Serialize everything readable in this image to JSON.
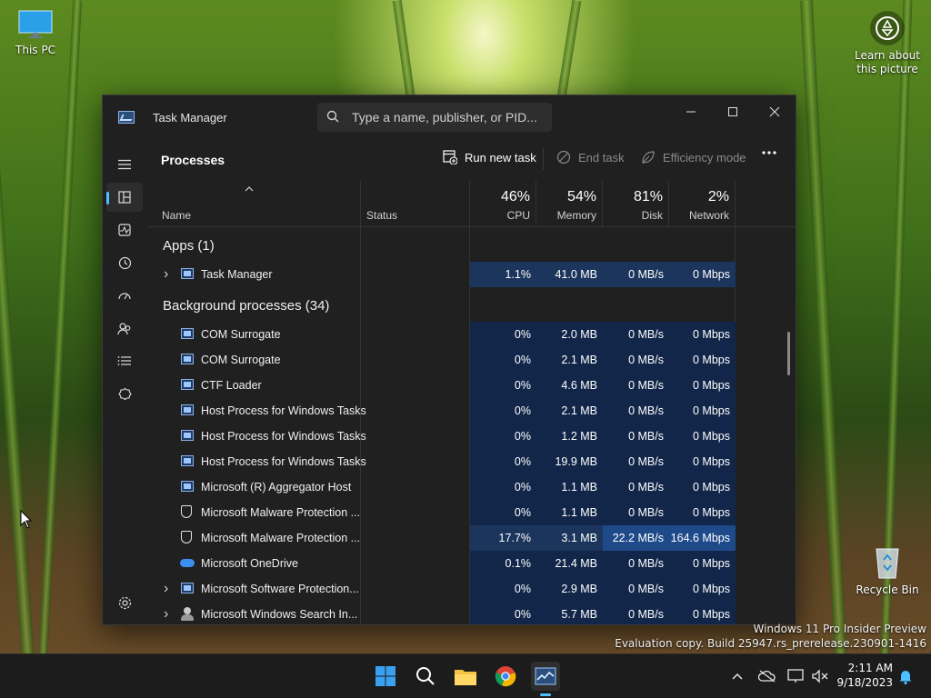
{
  "desktop": {
    "icons": [
      {
        "label": "This PC"
      },
      {
        "label": "Learn about this picture"
      },
      {
        "label": "Recycle Bin"
      }
    ]
  },
  "window": {
    "title": "Task Manager",
    "search_placeholder": "Type a name, publisher, or PID...",
    "controls": [
      "minimize",
      "maximize",
      "close"
    ]
  },
  "toolbar": {
    "page_title": "Processes",
    "run_new_task": "Run new task",
    "end_task": "End task",
    "efficiency_mode": "Efficiency mode",
    "more_icon": "more-icon"
  },
  "sidebar": {
    "items": [
      {
        "icon": "hamburger-icon",
        "name": "menu"
      },
      {
        "icon": "processes-icon",
        "name": "processes",
        "active": true
      },
      {
        "icon": "performance-icon",
        "name": "performance"
      },
      {
        "icon": "app-history-icon",
        "name": "app-history"
      },
      {
        "icon": "startup-apps-icon",
        "name": "startup-apps"
      },
      {
        "icon": "users-icon",
        "name": "users"
      },
      {
        "icon": "details-icon",
        "name": "details"
      },
      {
        "icon": "services-icon",
        "name": "services"
      },
      {
        "icon": "settings-icon",
        "name": "settings"
      }
    ]
  },
  "columns": {
    "name": "Name",
    "status": "Status",
    "cpu": {
      "label": "CPU",
      "pct": "46%"
    },
    "memory": {
      "label": "Memory",
      "pct": "54%"
    },
    "disk": {
      "label": "Disk",
      "pct": "81%"
    },
    "network": {
      "label": "Network",
      "pct": "2%"
    }
  },
  "groups": {
    "apps": "Apps (1)",
    "background": "Background processes (34)"
  },
  "apps": [
    {
      "name": "Task Manager",
      "cpu": "1.1%",
      "memory": "41.0 MB",
      "disk": "0 MB/s",
      "network": "0 Mbps",
      "expandable": true,
      "icon": "task-manager-icon"
    }
  ],
  "background": [
    {
      "name": "COM Surrogate",
      "cpu": "0%",
      "memory": "2.0 MB",
      "disk": "0 MB/s",
      "network": "0 Mbps",
      "icon": "window-icon"
    },
    {
      "name": "COM Surrogate",
      "cpu": "0%",
      "memory": "2.1 MB",
      "disk": "0 MB/s",
      "network": "0 Mbps",
      "icon": "window-icon"
    },
    {
      "name": "CTF Loader",
      "cpu": "0%",
      "memory": "4.6 MB",
      "disk": "0 MB/s",
      "network": "0 Mbps",
      "icon": "window-icon"
    },
    {
      "name": "Host Process for Windows Tasks",
      "cpu": "0%",
      "memory": "2.1 MB",
      "disk": "0 MB/s",
      "network": "0 Mbps",
      "icon": "window-icon"
    },
    {
      "name": "Host Process for Windows Tasks",
      "cpu": "0%",
      "memory": "1.2 MB",
      "disk": "0 MB/s",
      "network": "0 Mbps",
      "icon": "window-icon"
    },
    {
      "name": "Host Process for Windows Tasks",
      "cpu": "0%",
      "memory": "19.9 MB",
      "disk": "0 MB/s",
      "network": "0 Mbps",
      "icon": "window-icon"
    },
    {
      "name": "Microsoft (R) Aggregator Host",
      "cpu": "0%",
      "memory": "1.1 MB",
      "disk": "0 MB/s",
      "network": "0 Mbps",
      "icon": "window-icon"
    },
    {
      "name": "Microsoft Malware Protection ...",
      "cpu": "0%",
      "memory": "1.1 MB",
      "disk": "0 MB/s",
      "network": "0 Mbps",
      "icon": "shield-icon"
    },
    {
      "name": "Microsoft Malware Protection ...",
      "cpu": "17.7%",
      "memory": "3.1 MB",
      "disk": "22.2 MB/s",
      "network": "164.6 Mbps",
      "icon": "shield-icon",
      "hot": true
    },
    {
      "name": "Microsoft OneDrive",
      "cpu": "0.1%",
      "memory": "21.4 MB",
      "disk": "0 MB/s",
      "network": "0 Mbps",
      "icon": "cloud-icon"
    },
    {
      "name": "Microsoft Software Protection...",
      "cpu": "0%",
      "memory": "2.9 MB",
      "disk": "0 MB/s",
      "network": "0 Mbps",
      "icon": "window-icon",
      "expandable": true
    },
    {
      "name": "Microsoft Windows Search In...",
      "cpu": "0%",
      "memory": "5.7 MB",
      "disk": "0 MB/s",
      "network": "0 Mbps",
      "icon": "person-icon",
      "expandable": true
    }
  ],
  "watermark": {
    "line1": "Windows 11 Pro Insider Preview",
    "line2": "Evaluation copy. Build 25947.rs_prerelease.230901-1416"
  },
  "taskbar": {
    "apps": [
      "start-icon",
      "search-icon",
      "file-explorer-icon",
      "chrome-icon",
      "task-manager-icon"
    ],
    "time": "2:11 AM",
    "date": "9/18/2023"
  }
}
